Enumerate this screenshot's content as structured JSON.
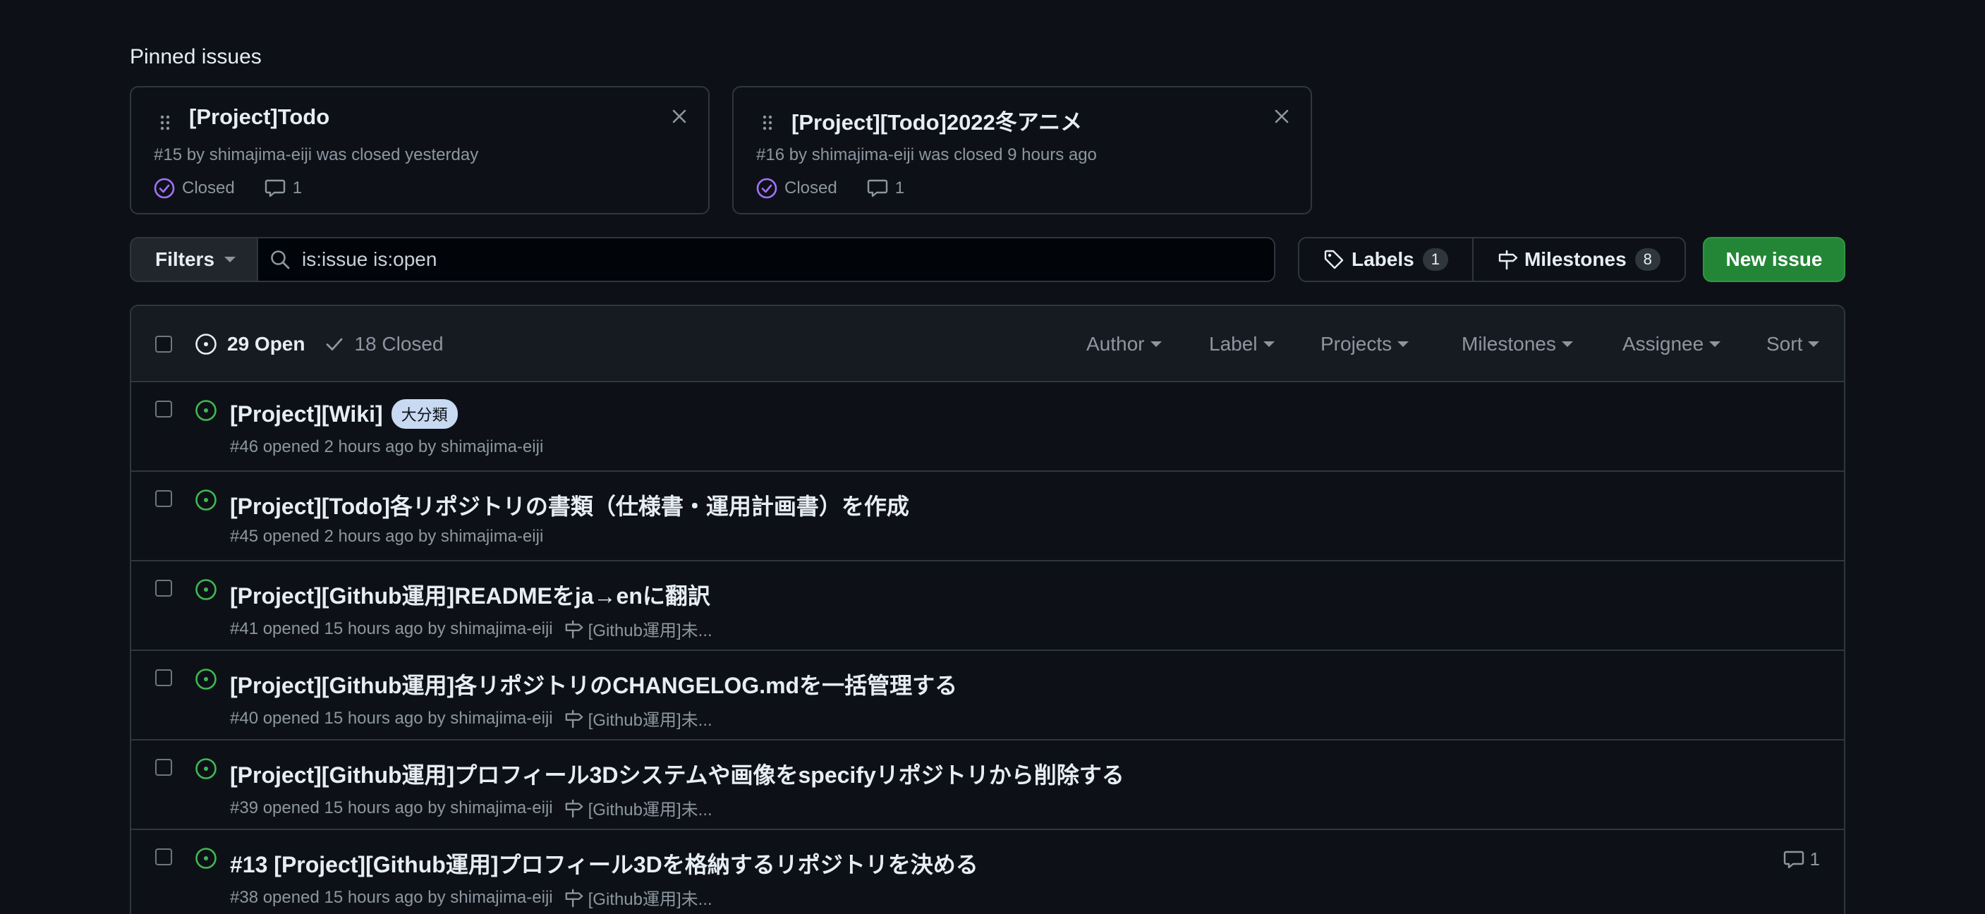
{
  "pinned": {
    "title": "Pinned issues",
    "cards": [
      {
        "title": "[Project]Todo",
        "meta": "#15 by shimajima-eiji was closed yesterday",
        "status": "Closed",
        "comments": "1"
      },
      {
        "title": "[Project][Todo]2022冬アニメ",
        "meta": "#16 by shimajima-eiji was closed 9 hours ago",
        "status": "Closed",
        "comments": "1"
      }
    ]
  },
  "toolbar": {
    "filters_label": "Filters",
    "search_value": "is:issue is:open",
    "labels_label": "Labels",
    "labels_count": "1",
    "milestones_label": "Milestones",
    "milestones_count": "8",
    "new_issue_label": "New issue"
  },
  "list_header": {
    "open_label": "29 Open",
    "closed_label": "18 Closed",
    "filters": [
      "Author",
      "Label",
      "Projects",
      "Milestones",
      "Assignee",
      "Sort"
    ]
  },
  "issues": [
    {
      "title": "[Project][Wiki]",
      "label": "大分類",
      "meta": "#46 opened 2 hours ago by shimajima-eiji",
      "milestone": "",
      "comments": ""
    },
    {
      "title": "[Project][Todo]各リポジトリの書類（仕様書・運用計画書）を作成",
      "label": "",
      "meta": "#45 opened 2 hours ago by shimajima-eiji",
      "milestone": "",
      "comments": ""
    },
    {
      "title": "[Project][Github運用]READMEをja→enに翻訳",
      "label": "",
      "meta": "#41 opened 15 hours ago by shimajima-eiji",
      "milestone": "[Github運用]未...",
      "comments": ""
    },
    {
      "title": "[Project][Github運用]各リポジトリのCHANGELOG.mdを一括管理する",
      "label": "",
      "meta": "#40 opened 15 hours ago by shimajima-eiji",
      "milestone": "[Github運用]未...",
      "comments": ""
    },
    {
      "title": "[Project][Github運用]プロフィール3Dシステムや画像をspecifyリポジトリから削除する",
      "label": "",
      "meta": "#39 opened 15 hours ago by shimajima-eiji",
      "milestone": "[Github運用]未...",
      "comments": ""
    },
    {
      "title": "#13 [Project][Github運用]プロフィール3Dを格納するリポジトリを決める",
      "label": "",
      "meta": "#38 opened 15 hours ago by shimajima-eiji",
      "milestone": "[Github運用]未...",
      "comments": "1"
    }
  ],
  "colors": {
    "open_icon": "#3fb950",
    "closed_icon": "#a371f7",
    "new_issue_bg": "#238636",
    "label_bg": "#c8d9f2"
  },
  "icons": [
    "grabber-icon",
    "x-icon",
    "check-circle-icon",
    "comment-icon",
    "search-icon",
    "tag-icon",
    "milestone-icon",
    "issue-opened-icon",
    "check-icon"
  ]
}
